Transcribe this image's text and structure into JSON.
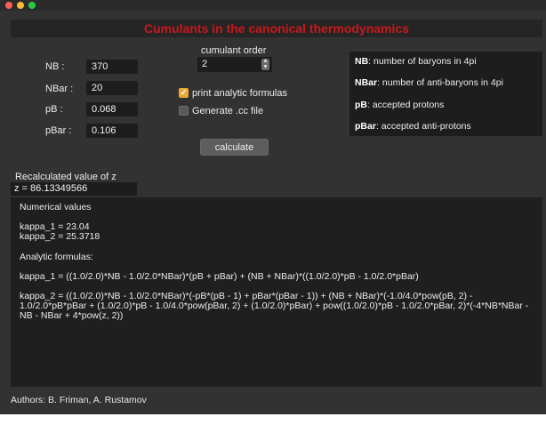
{
  "window": {
    "app_title": "Cumulants in the canonical thermodynamics",
    "title_color": "#c9181b"
  },
  "params": [
    {
      "label": "NB :",
      "value": "370"
    },
    {
      "label": "NBar :",
      "value": "20"
    },
    {
      "label": "pB :",
      "value": "0.068"
    },
    {
      "label": "pBar :",
      "value": "0.106"
    }
  ],
  "cumulant": {
    "label": "cumulant order",
    "value": "2",
    "stepper_icon": "stepper-icon"
  },
  "options": {
    "print_formulas": {
      "label": "print analytic formulas",
      "checked": true
    },
    "generate_cc": {
      "label": "Generate .cc file",
      "checked": false
    }
  },
  "calculate_label": "calculate",
  "legend": [
    {
      "key": "NB",
      "desc": ": number of baryons in 4pi"
    },
    {
      "key": "NBar",
      "desc": ": number of anti-baryons in 4pi"
    },
    {
      "key": "pB",
      "desc": ": accepted protons"
    },
    {
      "key": "pBar",
      "desc": ": accepted anti-protons"
    }
  ],
  "z": {
    "label": "Recalculated value of z",
    "value": "z = 86.13349566"
  },
  "output": {
    "heading": "Numerical values",
    "kappa1_value": "kappa_1 = 23.04",
    "kappa2_value": "kappa_2 = 25.3718",
    "analytic_heading": "Analytic formulas:",
    "kappa1_formula": "kappa_1 = ((1.0/2.0)*NB - 1.0/2.0*NBar)*(pB + pBar) + (NB + NBar)*((1.0/2.0)*pB - 1.0/2.0*pBar)",
    "kappa2_formula": "kappa_2 = ((1.0/2.0)*NB - 1.0/2.0*NBar)*(-pB*(pB - 1) + pBar*(pBar - 1)) + (NB + NBar)*(-1.0/4.0*pow(pB, 2) - 1.0/2.0*pB*pBar + (1.0/2.0)*pB - 1.0/4.0*pow(pBar, 2) + (1.0/2.0)*pBar) + pow((1.0/2.0)*pB - 1.0/2.0*pBar, 2)*(-4*NB*NBar - NB - NBar + 4*pow(z, 2))"
  },
  "authors": "Authors: B. Friman, A. Rustamov"
}
